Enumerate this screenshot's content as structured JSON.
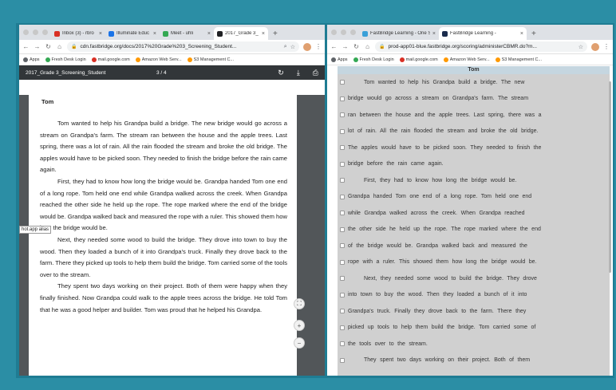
{
  "left": {
    "tabs": [
      {
        "label": "Inbox (3) - rbro",
        "color": "#d93025"
      },
      {
        "label": "Illuminate Educ",
        "color": "#1a73e8"
      },
      {
        "label": "Meet - uhli",
        "color": "#34a853"
      },
      {
        "label": "2017_Grade 3_",
        "color": "#202124"
      }
    ],
    "url": "cdn.fastbridge.org/docs/2017%20Grade%203_Screening_Student...",
    "bookmarks": [
      "Apps",
      "Fresh Desk Login",
      "mail.google.com",
      "Amazon Web Serv...",
      "S3 Management C..."
    ],
    "pdf_title": "2017_Grade 3_Screening_Student",
    "pdf_pages": "3 / 4",
    "story_title": "Tom",
    "paragraphs": [
      "Tom wanted to help his Grandpa build a bridge. The new bridge would go across a stream on Grandpa's farm. The stream ran between the house and the apple trees. Last spring, there was a lot of rain. All the rain flooded the stream and broke the old bridge. The apples would have to be picked soon. They needed to finish the bridge before the rain came again.",
      "First, they had to know how long the bridge would be. Grandpa handed Tom one end of a long rope. Tom held one end while Grandpa walked across the creek. When Grandpa reached the other side he held up the rope. The rope marked where the end of the bridge would be. Grandpa walked back and measured the rope with a ruler. This showed them how long the bridge would be.",
      "Next, they needed some wood to build the bridge. They drove into town to buy the wood. Then they loaded a bunch of it into Grandpa's truck. Finally they drove back to the farm. There they picked up tools to help them build the bridge. Tom carried some of the tools over to the stream.",
      "They spent two days working on their project. Both of them were happy when they finally finished. Now Grandpa could walk to the apple trees across the bridge. He told Tom that he was a good helper and builder. Tom was proud that he helped his Grandpa."
    ],
    "tooltip": "hot.app alias"
  },
  "right": {
    "tabs": [
      {
        "label": "FastBridge Learning - One Sim",
        "color": "#3aa0d8"
      },
      {
        "label": "FastBridge Learning -",
        "color": "#1a2b4c"
      }
    ],
    "url": "prod-app01-blue.fastbridge.org/scoring/administerCBMR.do?m...",
    "bookmarks": [
      "Apps",
      "Fresh Desk Login",
      "mail.google.com",
      "Amazon Web Serv...",
      "S3 Management C..."
    ],
    "story_title": "Tom",
    "lines": [
      {
        "text": "Tom wanted to help his Grandpa build a bridge. The new",
        "indent": true
      },
      {
        "text": "bridge would go across a stream on Grandpa's farm. The stream",
        "indent": false
      },
      {
        "text": "ran between the house and the apple trees. Last spring, there was a",
        "indent": false
      },
      {
        "text": "lot of rain. All the rain flooded the stream and broke the old bridge.",
        "indent": false
      },
      {
        "text": "The apples would have to be picked soon. They needed to finish the",
        "indent": false
      },
      {
        "text": "bridge before the rain came again.",
        "indent": false
      },
      {
        "text": "First, they had to know how long the bridge would be.",
        "indent": true
      },
      {
        "text": "Grandpa handed Tom one end of a long rope. Tom held one end",
        "indent": false
      },
      {
        "text": "while Grandpa walked across the creek. When Grandpa reached",
        "indent": false
      },
      {
        "text": "the other side he held up the rope. The rope marked where the end",
        "indent": false
      },
      {
        "text": "of the bridge would be. Grandpa walked back and measured the",
        "indent": false
      },
      {
        "text": "rope with a ruler. This showed them how long the bridge would be.",
        "indent": false
      },
      {
        "text": "Next, they needed some wood to build the bridge. They drove",
        "indent": true
      },
      {
        "text": "into town to buy the wood. Then they loaded a bunch of it into",
        "indent": false
      },
      {
        "text": "Grandpa's truck. Finally they drove back to the farm. There they",
        "indent": false
      },
      {
        "text": "picked up tools to help them build the bridge. Tom carried some of",
        "indent": false
      },
      {
        "text": "the tools over to the stream.",
        "indent": false
      },
      {
        "text": "They spent two days working on their project. Both of them",
        "indent": true
      }
    ]
  }
}
